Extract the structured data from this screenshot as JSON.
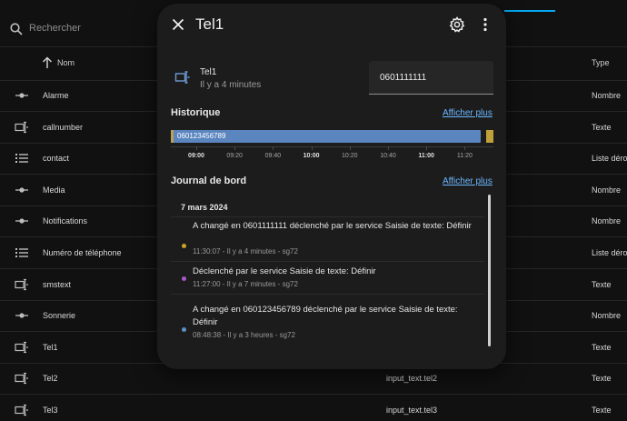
{
  "background": {
    "search_placeholder": "Rechercher",
    "col_name": "Nom",
    "col_type": "Type",
    "rows": [
      {
        "name": "Alarme",
        "type": "Nombre",
        "entity": "",
        "icon": "slider-icon"
      },
      {
        "name": "callnumber",
        "type": "Texte",
        "entity": "",
        "icon": "text-field-icon"
      },
      {
        "name": "contact",
        "type": "Liste dérou",
        "entity": "",
        "icon": "list-icon"
      },
      {
        "name": "Media",
        "type": "Nombre",
        "entity": "",
        "icon": "slider-icon"
      },
      {
        "name": "Notifications",
        "type": "Nombre",
        "entity": "",
        "icon": "slider-icon"
      },
      {
        "name": "Numéro de téléphone",
        "type": "Liste dérou",
        "entity": "",
        "icon": "list-icon"
      },
      {
        "name": "smstext",
        "type": "Texte",
        "entity": "",
        "icon": "text-field-icon"
      },
      {
        "name": "Sonnerie",
        "type": "Nombre",
        "entity": "",
        "icon": "slider-icon"
      },
      {
        "name": "Tel1",
        "type": "Texte",
        "entity": "",
        "icon": "text-field-icon"
      },
      {
        "name": "Tel2",
        "type": "Texte",
        "entity": "input_text.tel2",
        "icon": "text-field-icon"
      },
      {
        "name": "Tel3",
        "type": "Texte",
        "entity": "input_text.tel3",
        "icon": "text-field-icon"
      }
    ]
  },
  "dialog": {
    "title": "Tel1",
    "entity_name": "Tel1",
    "entity_time": "Il y a 4 minutes",
    "value": "0601111111",
    "history_title": "Historique",
    "history_link": "Afficher plus",
    "history_bar_label": "060123456789",
    "history_ticks": [
      {
        "label": "09:00",
        "bold": true
      },
      {
        "label": "09:20",
        "bold": false
      },
      {
        "label": "09:40",
        "bold": false
      },
      {
        "label": "10:00",
        "bold": true
      },
      {
        "label": "10:20",
        "bold": false
      },
      {
        "label": "10:40",
        "bold": false
      },
      {
        "label": "11:00",
        "bold": true
      },
      {
        "label": "11:20",
        "bold": false
      }
    ],
    "logbook_title": "Journal de bord",
    "logbook_link": "Afficher plus",
    "logbook_date": "7 mars 2024",
    "entries": [
      {
        "message": "A changé en 0601111111 déclenché par le service Saisie de texte: Définir",
        "meta": "11:30:07 - Il y a 4 minutes - sg72",
        "color": "#c9a227"
      },
      {
        "message": "Déclenché par le service Saisie de texte: Définir",
        "meta": "11:27:00 - Il y a 7 minutes - sg72",
        "color": "#a557c9"
      },
      {
        "message": "A changé en 060123456789 déclenché par le service Saisie de texte: Définir",
        "meta": "08:48:38 - Il y a 3 heures - sg72",
        "color": "#5f8fc4"
      }
    ]
  },
  "colors": {
    "accent_link": "#6bb7ff",
    "history_bar": "#5b85bf",
    "history_now": "#c0a03a"
  }
}
